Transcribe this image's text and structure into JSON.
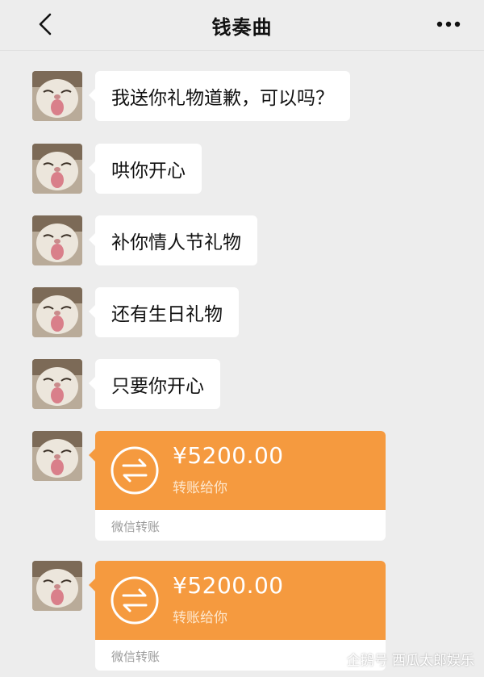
{
  "header": {
    "title": "钱奏曲",
    "back_icon": "chevron-left-icon",
    "more_icon": "more-dots-icon"
  },
  "messages": [
    {
      "type": "text",
      "text": "我送你礼物道歉，可以吗？"
    },
    {
      "type": "text",
      "text": "哄你开心"
    },
    {
      "type": "text",
      "text": "补你情人节礼物"
    },
    {
      "type": "text",
      "text": "还有生日礼物"
    },
    {
      "type": "text",
      "text": "只要你开心"
    },
    {
      "type": "transfer",
      "amount": "¥5200.00",
      "note": "转账给你",
      "footer": "微信转账"
    },
    {
      "type": "transfer",
      "amount": "¥5200.00",
      "note": "转账给你",
      "footer": "微信转账"
    }
  ],
  "colors": {
    "transfer_orange": "#f59a3f",
    "background": "#ededed",
    "bubble": "#ffffff"
  },
  "watermark": {
    "text": "企鹅号 西瓜太郎娱乐"
  }
}
